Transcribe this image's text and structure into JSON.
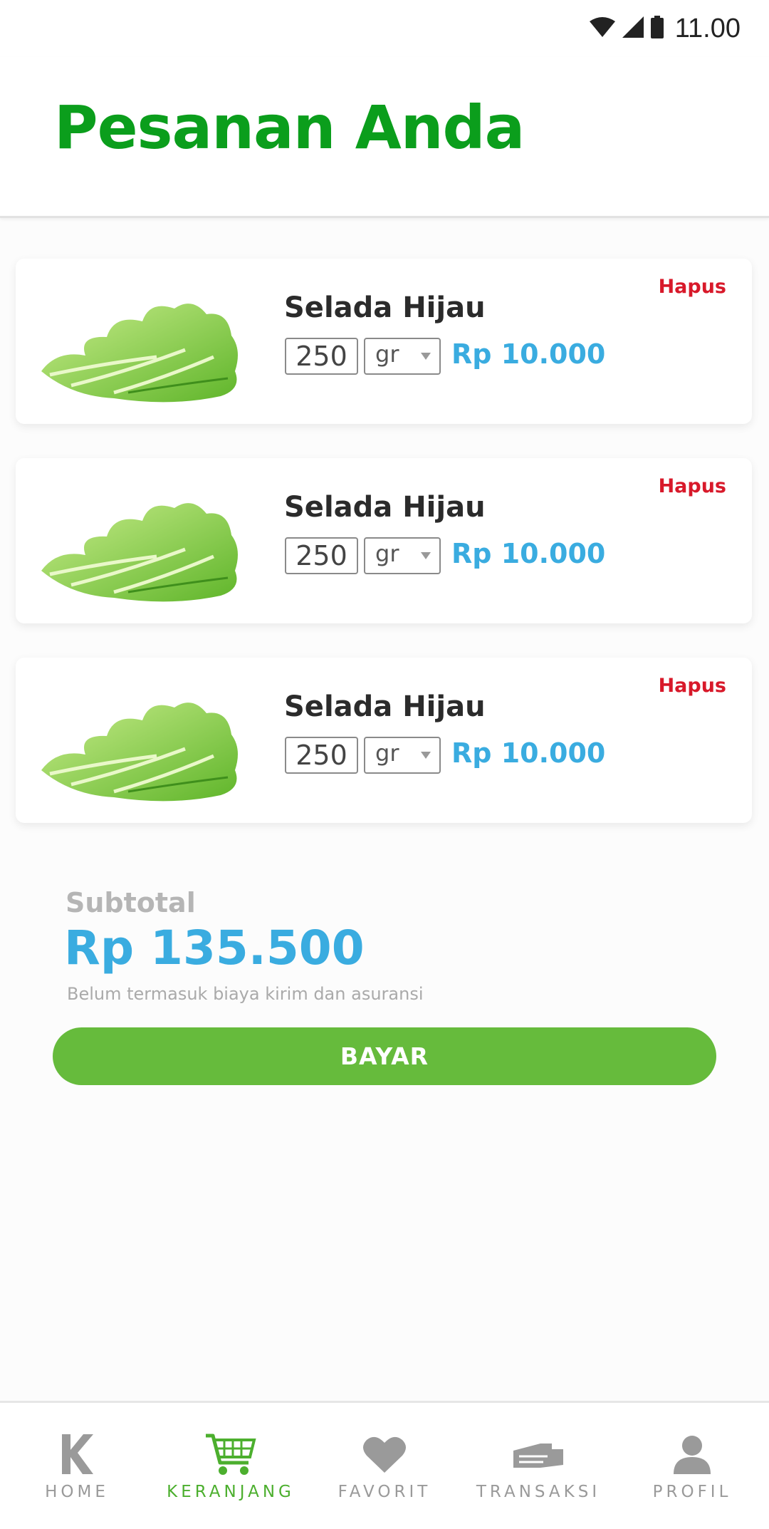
{
  "status_bar": {
    "time": "11.00",
    "icons": [
      "wifi-icon",
      "signal-icon",
      "battery-icon"
    ]
  },
  "header": {
    "title": "Pesanan Anda"
  },
  "cart": {
    "items": [
      {
        "name": "Selada Hijau",
        "quantity": "250",
        "unit": "gr",
        "price": "Rp 10.000",
        "delete_label": "Hapus",
        "image": "lettuce-image"
      },
      {
        "name": "Selada Hijau",
        "quantity": "250",
        "unit": "gr",
        "price": "Rp 10.000",
        "delete_label": "Hapus",
        "image": "lettuce-image"
      },
      {
        "name": "Selada Hijau",
        "quantity": "250",
        "unit": "gr",
        "price": "Rp 10.000",
        "delete_label": "Hapus",
        "image": "lettuce-image"
      }
    ]
  },
  "summary": {
    "subtotal_label": "Subtotal",
    "subtotal_value": "Rp 135.500",
    "note": "Belum termasuk biaya kirim dan asuransi",
    "pay_label": "BAYAR"
  },
  "bottom_nav": {
    "items": [
      {
        "label": "HOME",
        "icon": "home-k-icon",
        "active": false
      },
      {
        "label": "KERANJANG",
        "icon": "cart-icon",
        "active": true
      },
      {
        "label": "FAVORIT",
        "icon": "heart-icon",
        "active": false
      },
      {
        "label": "TRANSAKSI",
        "icon": "transaction-icon",
        "active": false
      },
      {
        "label": "PROFIL",
        "icon": "profile-icon",
        "active": false
      }
    ]
  },
  "colors": {
    "title_green": "#0b9e1c",
    "price_blue": "#3aace0",
    "delete_red": "#d8192a",
    "button_green": "#66bb3c",
    "nav_active": "#4caf2e",
    "nav_inactive": "#9a9a9a"
  }
}
